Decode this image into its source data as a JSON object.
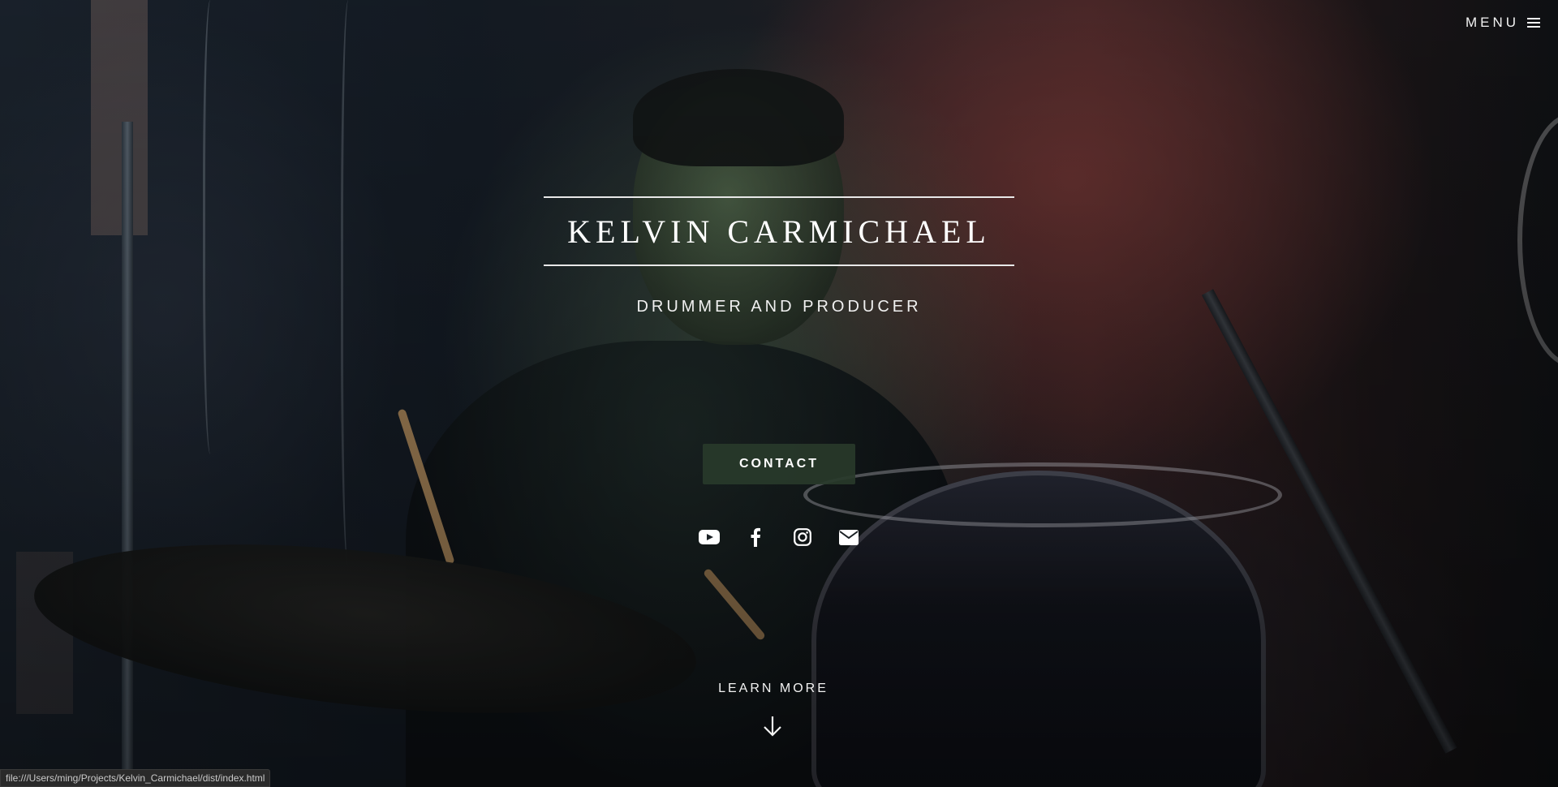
{
  "menu": {
    "label": "MENU",
    "icon": "hamburger-icon"
  },
  "hero": {
    "title": "KELVIN CARMICHAEL",
    "subtitle": "DRUMMER AND PRODUCER",
    "contact_label": "CONTACT",
    "accent_color": "#2a3b2a"
  },
  "socials": [
    {
      "icon": "youtube-icon"
    },
    {
      "icon": "facebook-icon"
    },
    {
      "icon": "instagram-icon"
    },
    {
      "icon": "envelope-icon"
    }
  ],
  "learn_more": {
    "label": "LEARN MORE",
    "icon": "arrow-down-icon"
  },
  "statusbar": {
    "url": "file:///Users/ming/Projects/Kelvin_Carmichael/dist/index.html"
  }
}
